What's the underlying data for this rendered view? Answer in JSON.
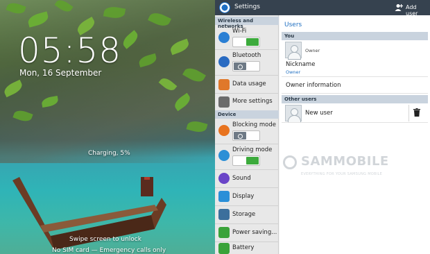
{
  "lockscreen": {
    "time": "05:58",
    "date": "Mon, 16 September",
    "charging": "Charging, 5%",
    "swipe_hint": "Swipe screen to unlock",
    "sim_status": "No SIM card — Emergency calls only"
  },
  "actionbar": {
    "title": "Settings",
    "app_icon": "settings-gear-icon",
    "add_user_label": "Add user",
    "add_user_icon": "add-user-icon"
  },
  "sidebar": {
    "sections": [
      {
        "header": "Wireless and networks",
        "items": [
          {
            "label": "Wi-Fi",
            "icon": "wifi-icon",
            "color": "#2a7fd4",
            "toggle": "on"
          },
          {
            "label": "Bluetooth",
            "icon": "bluetooth-icon",
            "color": "#2a6bc2",
            "toggle": "off"
          },
          {
            "label": "Data usage",
            "icon": "data-usage-icon",
            "color": "#e0782a",
            "toggle": null
          },
          {
            "label": "More settings",
            "icon": "more-settings-icon",
            "color": "#6b6b6b",
            "toggle": null
          }
        ]
      },
      {
        "header": "Device",
        "items": [
          {
            "label": "Blocking mode",
            "icon": "blocking-mode-icon",
            "color": "#e8731f",
            "toggle": "off"
          },
          {
            "label": "Driving mode",
            "icon": "driving-mode-icon",
            "color": "#2b8fd6",
            "toggle": "on"
          },
          {
            "label": "Sound",
            "icon": "sound-icon",
            "color": "#6a45c8",
            "toggle": null
          },
          {
            "label": "Display",
            "icon": "display-icon",
            "color": "#2a8fd8",
            "toggle": null
          },
          {
            "label": "Storage",
            "icon": "storage-icon",
            "color": "#3c6f9c",
            "toggle": null
          },
          {
            "label": "Power saving...",
            "icon": "power-saving-icon",
            "color": "#3aa33a",
            "toggle": null
          },
          {
            "label": "Battery",
            "icon": "battery-icon",
            "color": "#3aa33a",
            "toggle": null
          }
        ]
      }
    ]
  },
  "users": {
    "title": "Users",
    "you_header": "You",
    "owner_label": "Owner",
    "nickname_label": "Nickname",
    "nickname_value": "Owner",
    "owner_info_label": "Owner information",
    "other_users_header": "Other users",
    "new_user_label": "New user",
    "delete_icon": "trash-icon"
  },
  "watermark": {
    "main": "SAMMOBILE",
    "tagline": "EVERYTHING FOR YOUR SAMSUNG MOBILE"
  },
  "colors": {
    "actionbar": "#36424f",
    "accent": "#1f6fc1",
    "toggle_on": "#3caa3c",
    "section_header": "#c9d3de"
  }
}
